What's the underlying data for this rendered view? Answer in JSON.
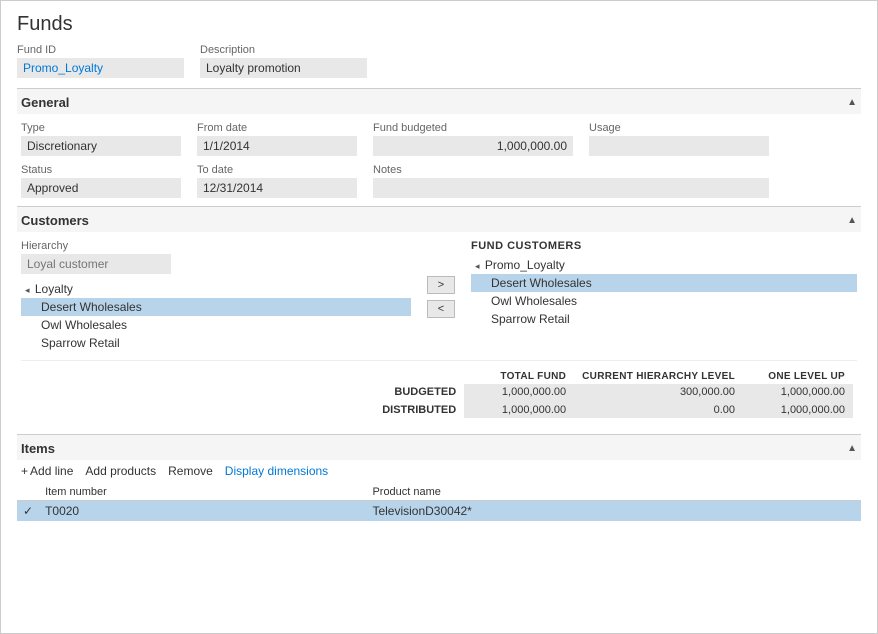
{
  "page": {
    "title": "Funds"
  },
  "fund": {
    "id_label": "Fund ID",
    "id_value": "Promo_Loyalty",
    "desc_label": "Description",
    "desc_value": "Loyalty promotion"
  },
  "general": {
    "section_title": "General",
    "type_label": "Type",
    "type_value": "Discretionary",
    "from_date_label": "From date",
    "from_date_value": "1/1/2014",
    "fund_budgeted_label": "Fund budgeted",
    "fund_budgeted_value": "1,000,000.00",
    "usage_label": "Usage",
    "usage_value": "",
    "status_label": "Status",
    "status_value": "Approved",
    "to_date_label": "To date",
    "to_date_value": "12/31/2014",
    "notes_label": "Notes",
    "notes_value": ""
  },
  "customers": {
    "section_title": "Customers",
    "hierarchy_label": "Hierarchy",
    "hierarchy_placeholder": "Loyal customer",
    "transfer_right": ">",
    "transfer_left": "<",
    "fund_customers_label": "FUND CUSTOMERS",
    "left_tree": [
      {
        "label": "Loyalty",
        "indent": 0,
        "arrow": true
      },
      {
        "label": "Desert Wholesales",
        "indent": 1,
        "selected": true
      },
      {
        "label": "Owl Wholesales",
        "indent": 1
      },
      {
        "label": "Sparrow Retail",
        "indent": 1
      }
    ],
    "right_tree": [
      {
        "label": "Promo_Loyalty",
        "indent": 0,
        "arrow": true
      },
      {
        "label": "Desert Wholesales",
        "indent": 1,
        "selected": true
      },
      {
        "label": "Owl Wholesales",
        "indent": 1
      },
      {
        "label": "Sparrow Retail",
        "indent": 1
      }
    ]
  },
  "totals": {
    "col_total_fund": "TOTAL FUND",
    "col_current_hierarchy": "CURRENT HIERARCHY LEVEL",
    "col_one_level_up": "ONE LEVEL UP",
    "rows": [
      {
        "label": "BUDGETED",
        "total_fund": "1,000,000.00",
        "current_hierarchy": "300,000.00",
        "one_level_up": "1,000,000.00"
      },
      {
        "label": "DISTRIBUTED",
        "total_fund": "1,000,000.00",
        "current_hierarchy": "0.00",
        "one_level_up": "1,000,000.00"
      }
    ]
  },
  "items": {
    "section_title": "Items",
    "toolbar": {
      "add_line": "Add line",
      "add_products": "Add products",
      "remove": "Remove",
      "display_dimensions": "Display dimensions"
    },
    "columns": [
      {
        "label": ""
      },
      {
        "label": "Item number"
      },
      {
        "label": "Product name"
      }
    ],
    "rows": [
      {
        "check": "✓",
        "item_number": "T0020",
        "product_name": "TelevisionD30042*",
        "selected": true
      }
    ]
  }
}
